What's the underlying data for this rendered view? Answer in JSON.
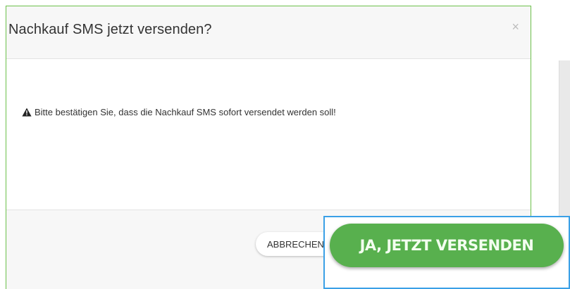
{
  "modal": {
    "title": "Nachkauf SMS jetzt versenden?",
    "close_glyph": "×",
    "warning_icon": "warning-triangle-icon",
    "message": "Bitte bestätigen Sie, dass die Nachkauf SMS sofort versendet werden soll!"
  },
  "footer": {
    "cancel_label": "ABBRECHEN",
    "confirm_label": "JA, JETZT VERSENDEN"
  },
  "colors": {
    "modal_border": "#6cc04a",
    "confirm_button": "#58b04e",
    "inset_border": "#3aa0e6"
  }
}
